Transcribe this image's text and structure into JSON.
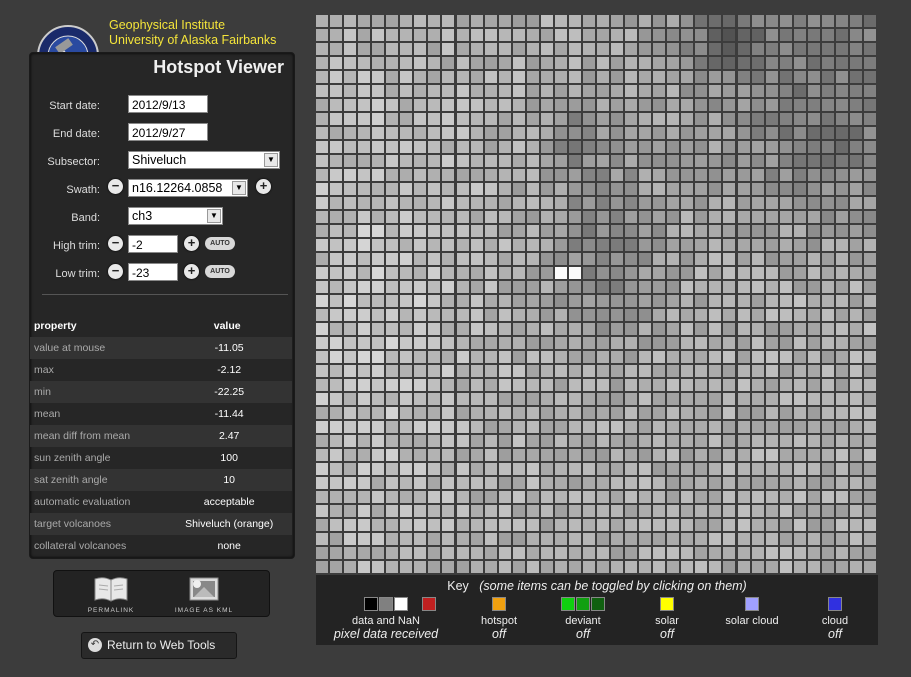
{
  "institute": {
    "line1": "Geophysical Institute",
    "line2": "University of Alaska Fairbanks",
    "logo_text": "ALASKA VOLCANO OBSERVATORY"
  },
  "title": "Hotspot Viewer",
  "form": {
    "start_label": "Start date:",
    "start_value": "2012/9/13",
    "end_label": "End date:",
    "end_value": "2012/9/27",
    "subsector_label": "Subsector:",
    "subsector_value": "Shiveluch",
    "swath_label": "Swath:",
    "swath_value": "n16.12264.0858",
    "band_label": "Band:",
    "band_value": "ch3",
    "high_trim_label": "High trim:",
    "high_trim_value": "-2",
    "low_trim_label": "Low trim:",
    "low_trim_value": "-23",
    "auto_label": "AUTO"
  },
  "properties": {
    "col_property": "property",
    "col_value": "value",
    "rows": [
      {
        "k": "value at mouse",
        "v": "-11.05"
      },
      {
        "k": "max",
        "v": "-2.12"
      },
      {
        "k": "min",
        "v": "-22.25"
      },
      {
        "k": "mean",
        "v": "-11.44"
      },
      {
        "k": "mean diff from mean",
        "v": "2.47"
      },
      {
        "k": "sun zenith angle",
        "v": "100"
      },
      {
        "k": "sat zenith angle",
        "v": "10"
      },
      {
        "k": "automatic evaluation",
        "v": "acceptable"
      },
      {
        "k": "target volcanoes",
        "v": "Shiveluch (orange)"
      },
      {
        "k": "collateral volcanoes",
        "v": "none"
      }
    ]
  },
  "toolbar": {
    "permalink_label": "PERMALINK",
    "kml_label": "IMAGE AS KML"
  },
  "web_tools_label": "Return to Web Tools",
  "key": {
    "title": "Key",
    "subtitle": "(some items can be toggled by clicking on them)",
    "items": [
      {
        "label": "data and NaN",
        "status": "pixel data received",
        "colors": [
          "#000000",
          "#808080",
          "#ffffff"
        ]
      },
      {
        "label": "",
        "status": "",
        "colors": [
          "#c02020"
        ]
      },
      {
        "label": "hotspot",
        "status": "off",
        "colors": [
          "#f0a010"
        ]
      },
      {
        "label": "deviant",
        "status": "off",
        "colors": [
          "#10d010",
          "#10a010",
          "#106010"
        ]
      },
      {
        "label": "solar",
        "status": "off",
        "colors": [
          "#ffff00"
        ]
      },
      {
        "label": "solar cloud",
        "status": "",
        "colors": [
          "#a0a0ff"
        ]
      },
      {
        "label": "cloud",
        "status": "off",
        "colors": [
          "#3030e0"
        ]
      }
    ]
  },
  "colors": {
    "accent_yellow": "#f5e53a",
    "background": "#3c3c3c",
    "panel": "#262626"
  }
}
